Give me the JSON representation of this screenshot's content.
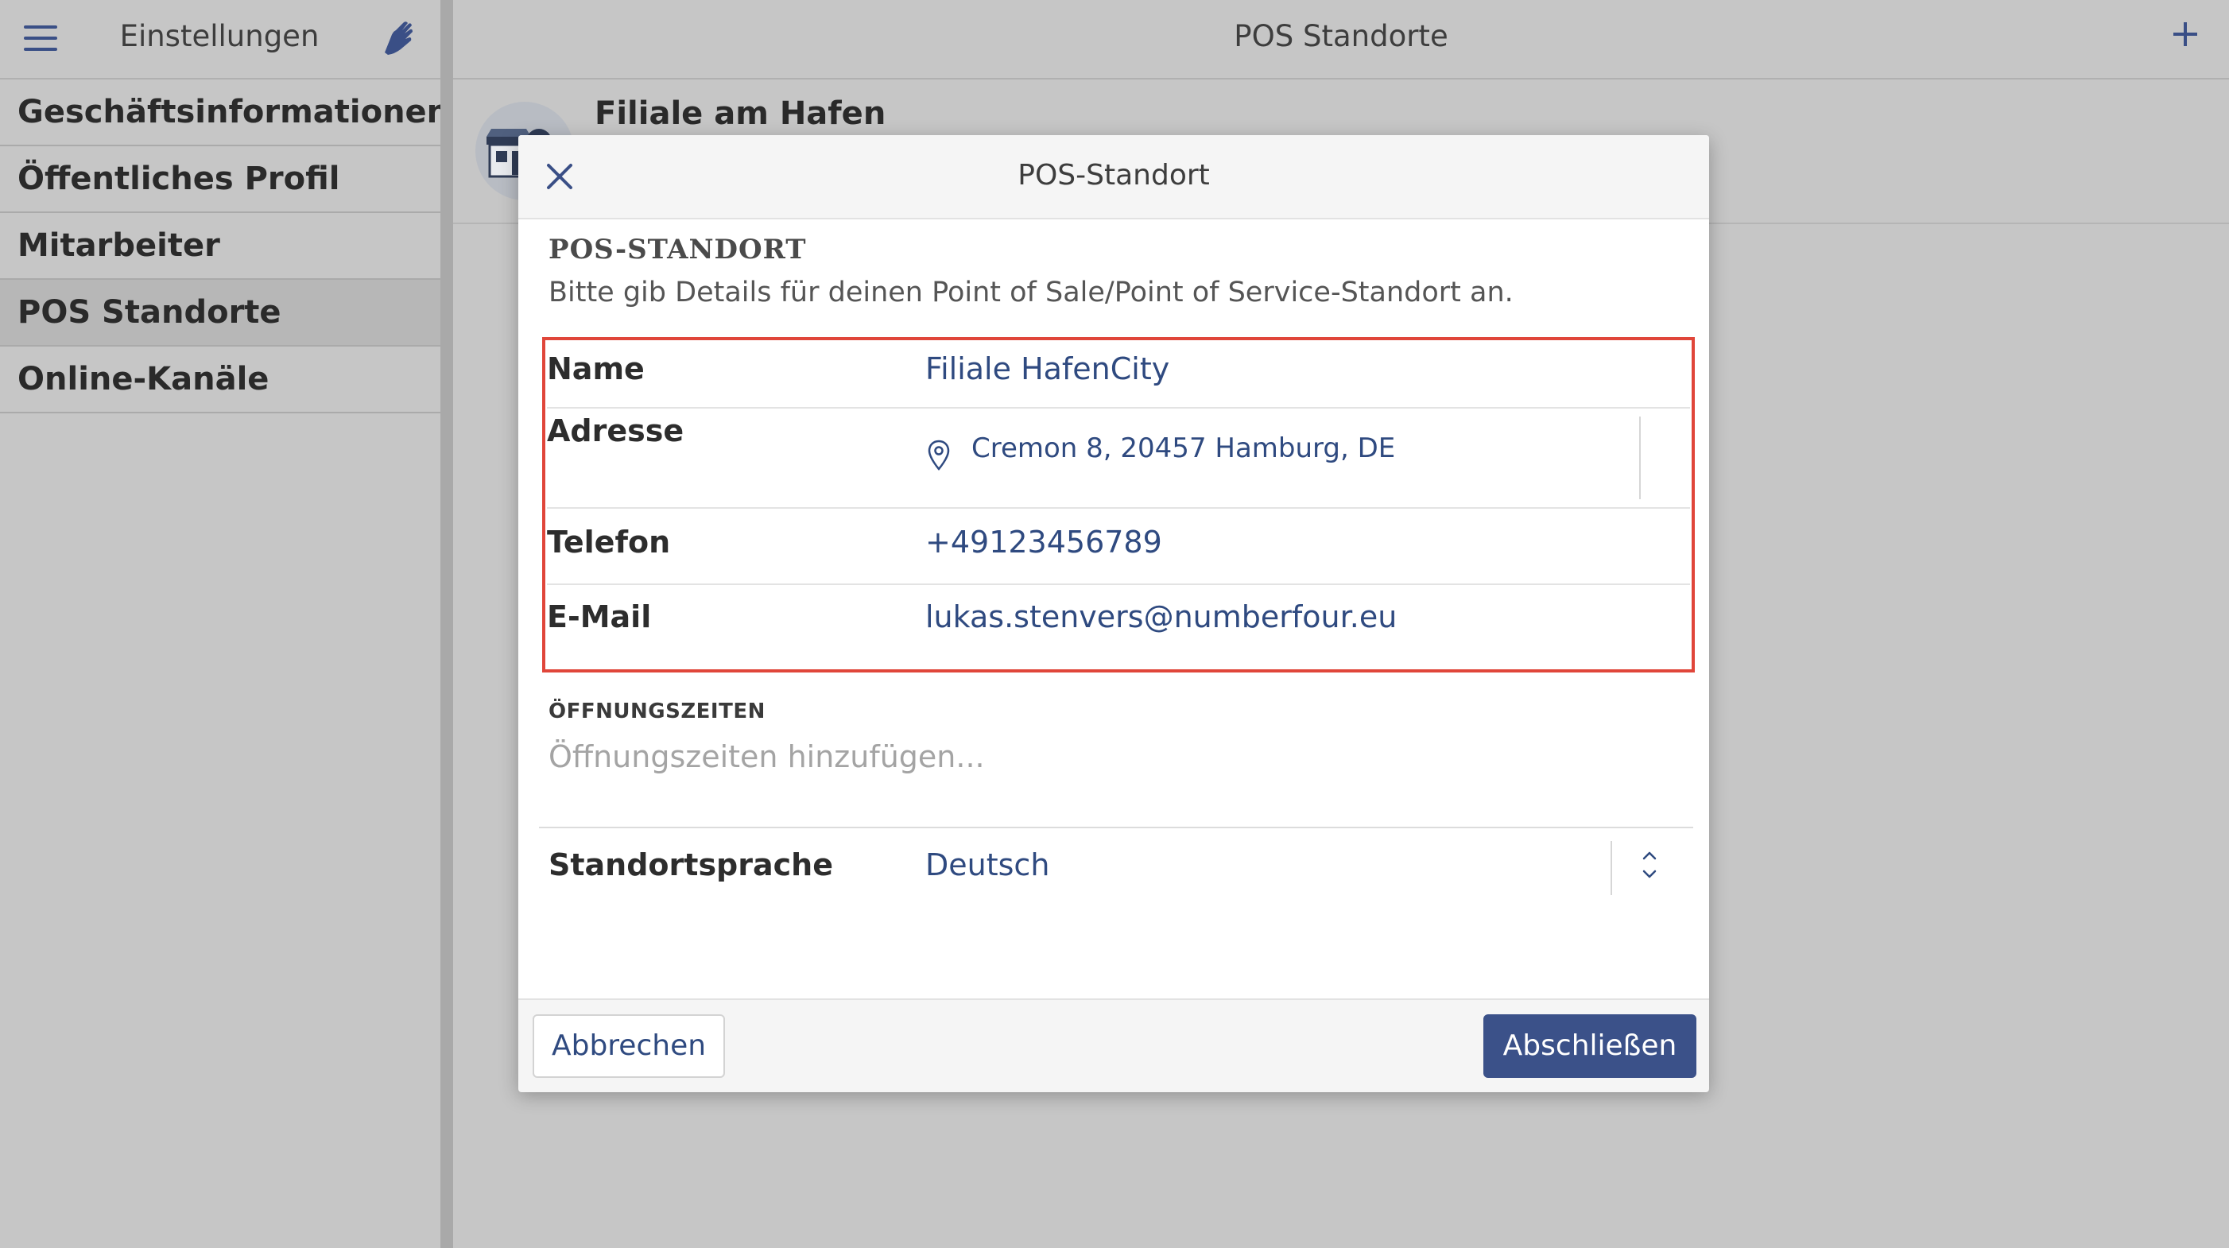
{
  "sidebar": {
    "title": "Einstellungen",
    "items": [
      {
        "label": "Geschäftsinformationen"
      },
      {
        "label": "Öffentliches Profil"
      },
      {
        "label": "Mitarbeiter"
      },
      {
        "label": "POS Standorte",
        "active": true
      },
      {
        "label": "Online-Kanäle"
      }
    ]
  },
  "main": {
    "title": "POS Standorte",
    "list": [
      {
        "title": "Filiale am Hafen"
      }
    ]
  },
  "modal": {
    "title": "POS-Standort",
    "section_title": "POS-STANDORT",
    "section_description": "Bitte gib Details für deinen Point of Sale/Point of Service-Standort an.",
    "fields": {
      "name": {
        "label": "Name",
        "value": "Filiale HafenCity"
      },
      "address": {
        "label": "Adresse",
        "value": "Cremon 8, 20457 Hamburg, DE"
      },
      "phone": {
        "label": "Telefon",
        "value": "+49123456789"
      },
      "email": {
        "label": "E-Mail",
        "value": "lukas.stenvers@numberfour.eu"
      }
    },
    "opening_hours": {
      "label": "ÖFFNUNGSZEITEN",
      "placeholder": "Öffnungszeiten hinzufügen..."
    },
    "language": {
      "label": "Standortsprache",
      "value": "Deutsch"
    },
    "buttons": {
      "cancel": "Abbrechen",
      "submit": "Abschließen"
    }
  },
  "colors": {
    "accent": "#3b5189",
    "link_text": "#2f4a80",
    "highlight_border": "#e0463a",
    "background": "#c6c6c6"
  },
  "icons": {
    "menu": "hamburger-menu-icon",
    "brand": "hand-logo-icon",
    "add": "plus-icon",
    "store": "store-icon",
    "close": "close-icon",
    "location": "location-pin-icon",
    "stepper": "chevron-up-down-icon"
  }
}
